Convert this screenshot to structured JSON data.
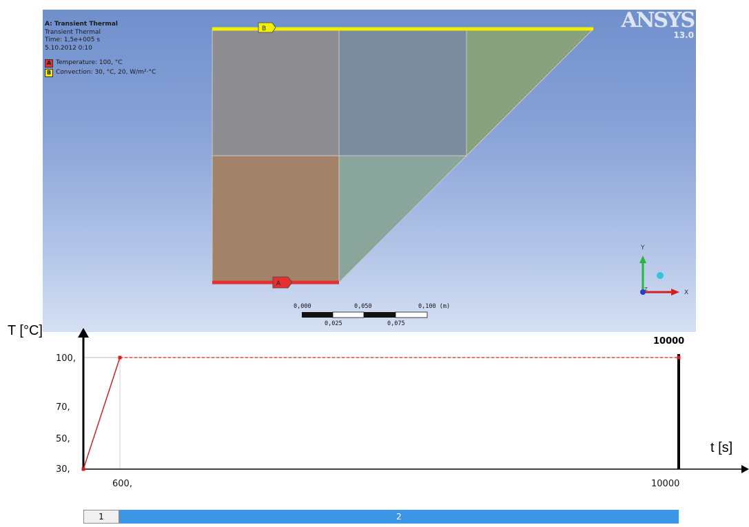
{
  "info": {
    "title": "A: Transient Thermal",
    "subtitle": "Transient Thermal",
    "time": "Time: 1,5e+005 s",
    "date": "5.10.2012 0:10",
    "legend": [
      {
        "key": "A",
        "text": "Temperature: 100, °C",
        "color": "#e53030"
      },
      {
        "key": "B",
        "text": "Convection: 30, °C, 20, W/m²·°C",
        "color": "#f0f000"
      }
    ]
  },
  "logo": {
    "name": "ANSYS",
    "version": "13.0"
  },
  "flags": {
    "a": "A",
    "b": "B"
  },
  "scale_bar": {
    "top": [
      "0,000",
      "0,050",
      "0,100 (m)"
    ],
    "bottom": [
      "0,025",
      "0,075"
    ]
  },
  "triad": {
    "y": "Y",
    "x": "X",
    "z": "Z"
  },
  "colors": {
    "fixed_temp": "#e53030",
    "convection": "#f0f000"
  },
  "chart": {
    "y_axis_label": "T [°C]",
    "x_axis_label": "t [s]",
    "y_ticks": [
      "100,",
      "70,",
      "50,",
      "30,"
    ],
    "x_ticks": [
      "600,",
      "10000"
    ],
    "end_marker": "10000"
  },
  "chart_data": {
    "type": "line",
    "title": "",
    "xlabel": "t [s]",
    "ylabel": "T [°C]",
    "series": [
      {
        "values": [
          [
            0,
            30
          ],
          [
            600,
            100
          ],
          [
            10000,
            100
          ]
        ]
      }
    ],
    "xlim": [
      0,
      10000
    ],
    "ylim": [
      30,
      100
    ],
    "y_ticks": [
      30,
      50,
      70,
      100
    ],
    "x_ticks": [
      600,
      10000
    ]
  },
  "steps": {
    "step1": "1",
    "step2": "2"
  }
}
